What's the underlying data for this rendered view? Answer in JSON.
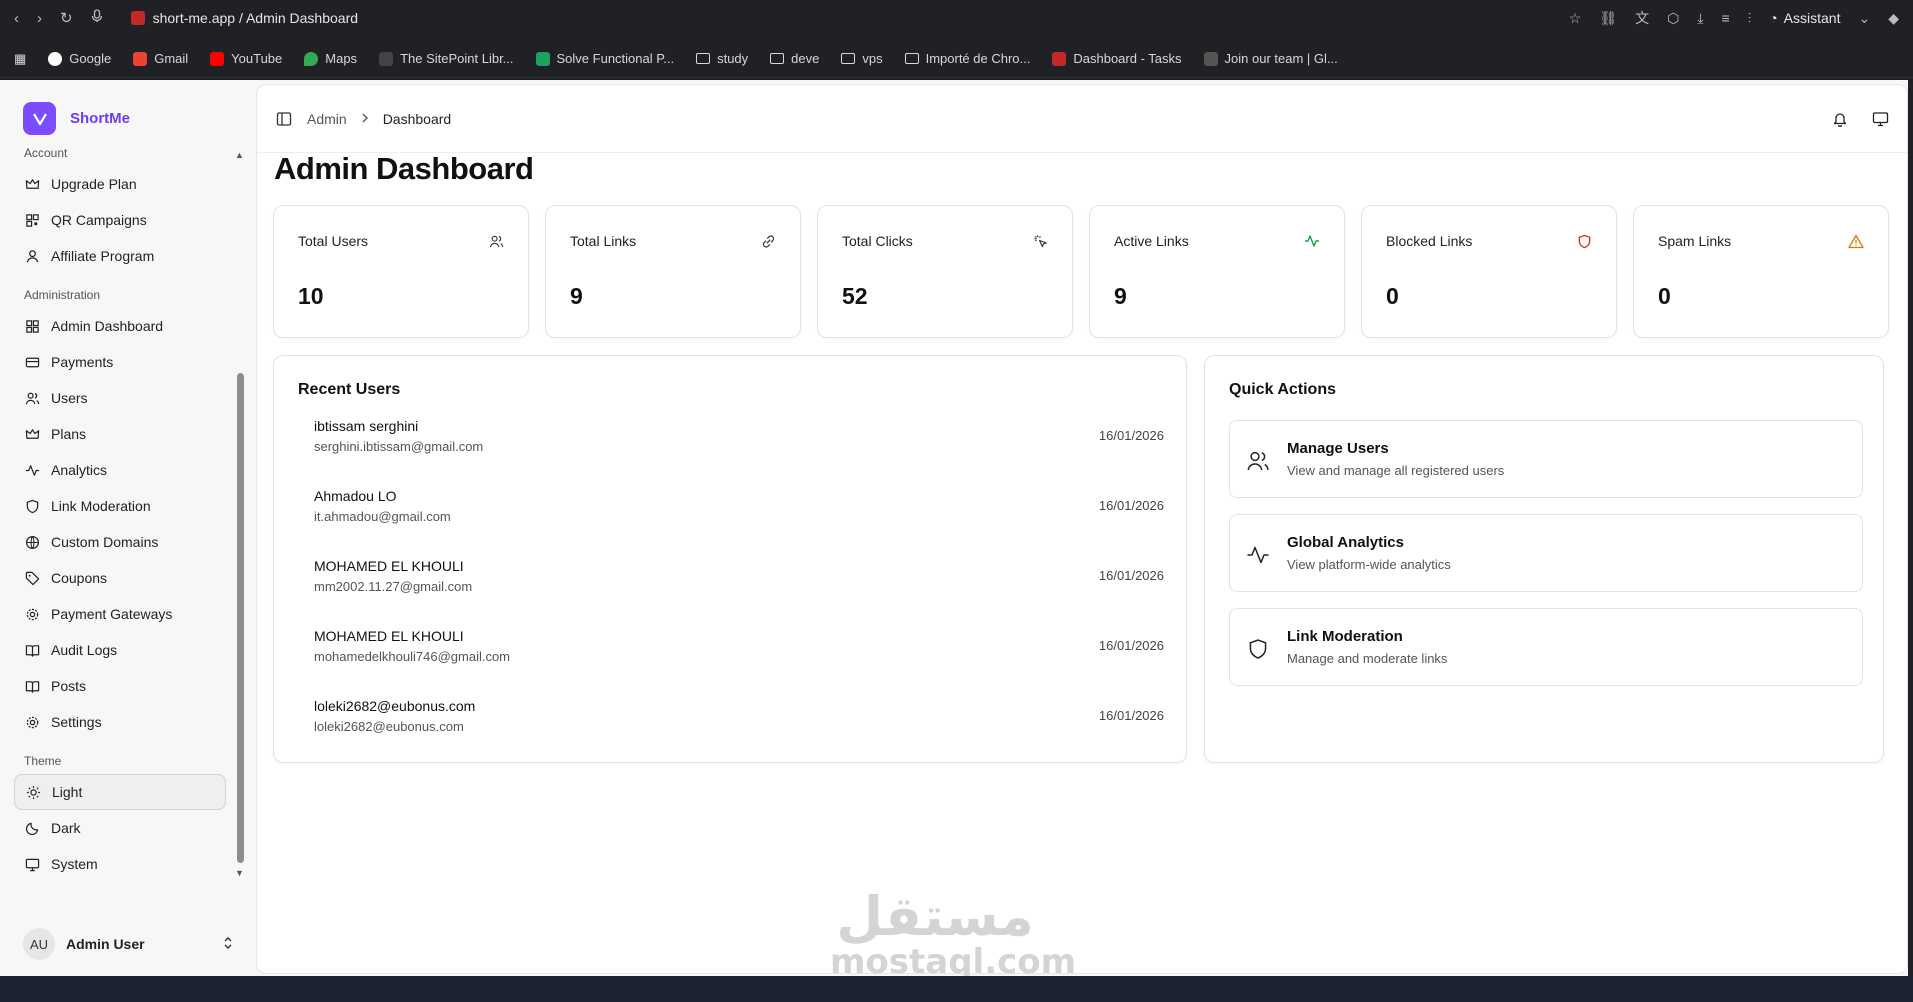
{
  "browser": {
    "url": "short-me.app / Admin Dashboard",
    "assistant_label": "Assistant",
    "bookmarks": [
      "Google",
      "Gmail",
      "YouTube",
      "Maps",
      "The SitePoint Libr...",
      "Solve Functional P...",
      "study",
      "deve",
      "vps",
      "Importé de Chro...",
      "Dashboard - Tasks",
      "Join our team | Gl..."
    ]
  },
  "brand": {
    "name": "ShortMe",
    "color": "#7c4dff"
  },
  "sidebar": {
    "account_label": "Account",
    "account_items": [
      "Upgrade Plan",
      "QR Campaigns",
      "Affiliate Program"
    ],
    "admin_label": "Administration",
    "admin_items": [
      "Admin Dashboard",
      "Payments",
      "Users",
      "Plans",
      "Analytics",
      "Link Moderation",
      "Custom Domains",
      "Coupons",
      "Payment Gateways",
      "Audit Logs",
      "Posts",
      "Settings"
    ],
    "theme_label": "Theme",
    "theme_items": [
      "Light",
      "Dark",
      "System"
    ],
    "user": {
      "initials": "AU",
      "name": "Admin User"
    }
  },
  "breadcrumb": {
    "parent": "Admin",
    "current": "Dashboard"
  },
  "page_title": "Admin Dashboard",
  "stats": [
    {
      "label": "Total Users",
      "value": "10",
      "icon": "users-icon"
    },
    {
      "label": "Total Links",
      "value": "9",
      "icon": "link-icon"
    },
    {
      "label": "Total Clicks",
      "value": "52",
      "icon": "click-icon"
    },
    {
      "label": "Active Links",
      "value": "9",
      "icon": "activity-icon",
      "color": "#16a34a"
    },
    {
      "label": "Blocked Links",
      "value": "0",
      "icon": "shield-icon",
      "color": "#dc2626"
    },
    {
      "label": "Spam Links",
      "value": "0",
      "icon": "warning-icon",
      "color": "#d97706"
    }
  ],
  "recent_users": {
    "title": "Recent Users",
    "rows": [
      {
        "name": "ibtissam serghini",
        "email": "serghini.ibtissam@gmail.com",
        "date": "16/01/2026"
      },
      {
        "name": "Ahmadou LO",
        "email": "it.ahmadou@gmail.com",
        "date": "16/01/2026"
      },
      {
        "name": "MOHAMED EL KHOULI",
        "email": "mm2002.11.27@gmail.com",
        "date": "16/01/2026"
      },
      {
        "name": "MOHAMED EL KHOULI",
        "email": "mohamedelkhouli746@gmail.com",
        "date": "16/01/2026"
      },
      {
        "name": "loleki2682@eubonus.com",
        "email": "loleki2682@eubonus.com",
        "date": "16/01/2026"
      }
    ]
  },
  "quick_actions": {
    "title": "Quick Actions",
    "items": [
      {
        "title": "Manage Users",
        "desc": "View and manage all registered users"
      },
      {
        "title": "Global Analytics",
        "desc": "View platform-wide analytics"
      },
      {
        "title": "Link Moderation",
        "desc": "Manage and moderate links"
      }
    ]
  },
  "watermark": {
    "arabic": "مستقل",
    "latin": "mostaql.com"
  }
}
